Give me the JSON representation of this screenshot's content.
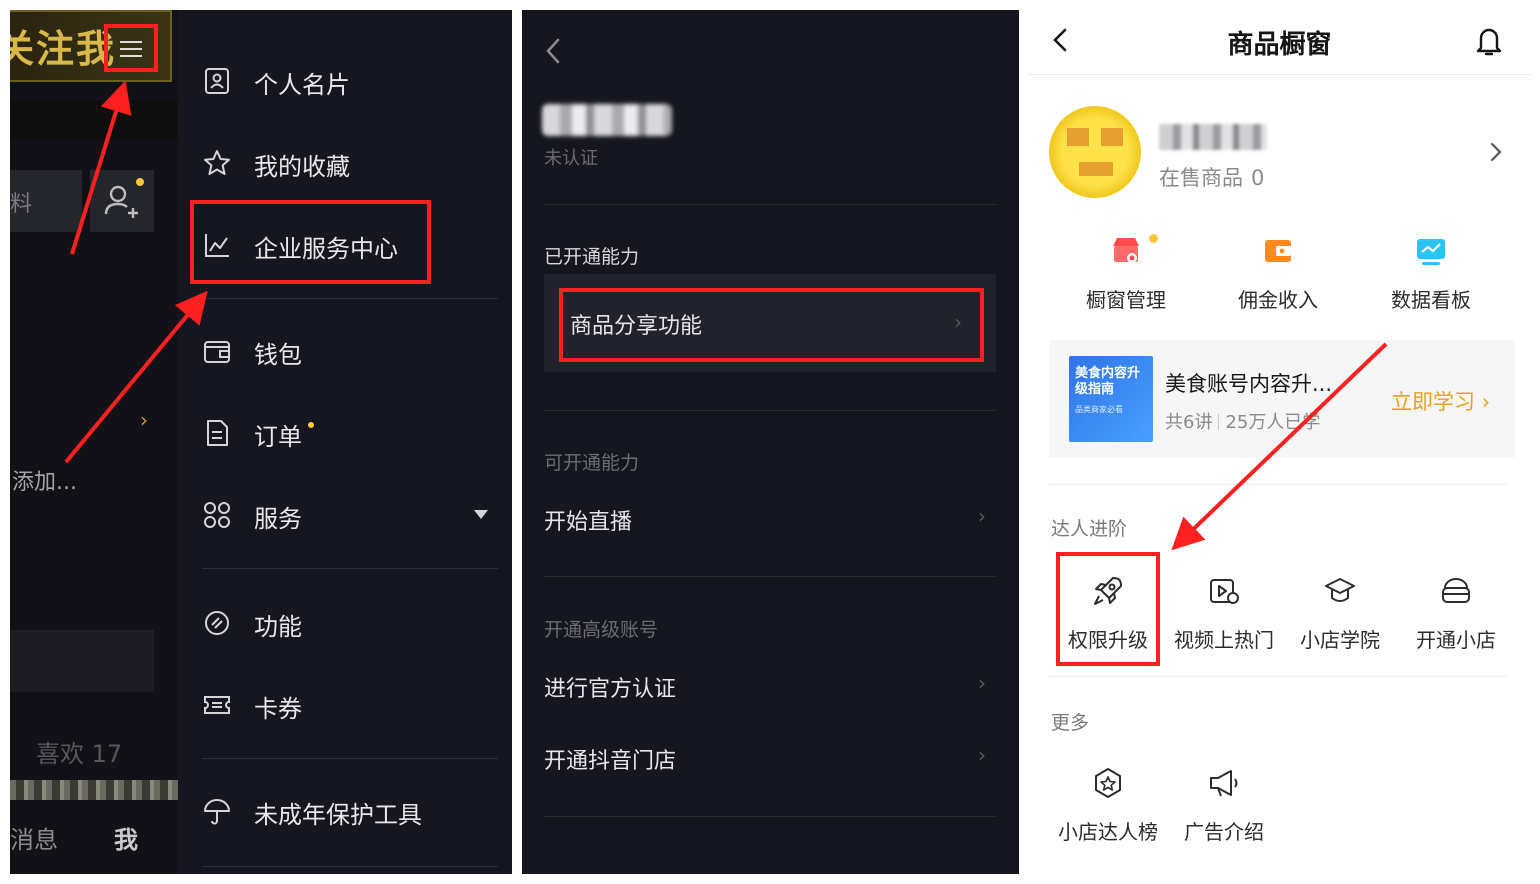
{
  "panel1": {
    "banner_text": "关注我",
    "profile_tab_partial": "料",
    "add_text_partial": "添加...",
    "likes_text": "喜欢 17",
    "bottom_nav": {
      "messages_partial": "消息",
      "me": "我"
    },
    "menu": [
      {
        "label": "个人名片",
        "icon": "id-card-icon"
      },
      {
        "label": "我的收藏",
        "icon": "star-icon"
      },
      {
        "label": "企业服务中心",
        "icon": "line-chart-icon",
        "highlighted": true
      },
      {
        "label": "钱包",
        "icon": "wallet-icon"
      },
      {
        "label": "订单",
        "icon": "order-icon",
        "badge_dot": true
      },
      {
        "label": "服务",
        "icon": "grid-icon",
        "has_dropdown": true
      },
      {
        "label": "功能",
        "icon": "function-icon"
      },
      {
        "label": "卡券",
        "icon": "ticket-icon"
      },
      {
        "label": "未成年保护工具",
        "icon": "umbrella-icon"
      }
    ]
  },
  "panel2": {
    "unverified": "未认证",
    "sections": {
      "enabled": "已开通能力",
      "available": "可开通能力",
      "advanced": "开通高级账号"
    },
    "rows": {
      "share": "商品分享功能",
      "live": "开始直播",
      "official": "进行官方认证",
      "store": "开通抖音门店"
    }
  },
  "panel3": {
    "title": "商品橱窗",
    "onsale_label": "在售商品",
    "onsale_count": "0",
    "tools": [
      {
        "label": "橱窗管理",
        "icon": "shop-manage-icon"
      },
      {
        "label": "佣金收入",
        "icon": "commission-wallet-icon"
      },
      {
        "label": "数据看板",
        "icon": "data-board-icon"
      }
    ],
    "course": {
      "thumb_title": "美食内容升级指南",
      "thumb_sub": "品类商家必看",
      "title": "美食账号内容升...",
      "lessons": "共6讲",
      "learners": "25万人已学",
      "cta": "立即学习"
    },
    "sections": {
      "advance": "达人进阶",
      "more": "更多"
    },
    "advance_items": [
      {
        "label": "权限升级",
        "icon": "rocket-icon",
        "highlighted": true
      },
      {
        "label": "视频上热门",
        "icon": "video-hot-icon"
      },
      {
        "label": "小店学院",
        "icon": "graduation-cap-icon"
      },
      {
        "label": "开通小店",
        "icon": "open-store-icon"
      }
    ],
    "more_items": [
      {
        "label": "小店达人榜",
        "icon": "ranking-badge-icon"
      },
      {
        "label": "广告介绍",
        "icon": "megaphone-icon"
      }
    ]
  },
  "colors": {
    "highlight": "#ff2020",
    "dark_bg": "#161620",
    "gold": "#e6a225",
    "badge": "#ffc53d"
  }
}
